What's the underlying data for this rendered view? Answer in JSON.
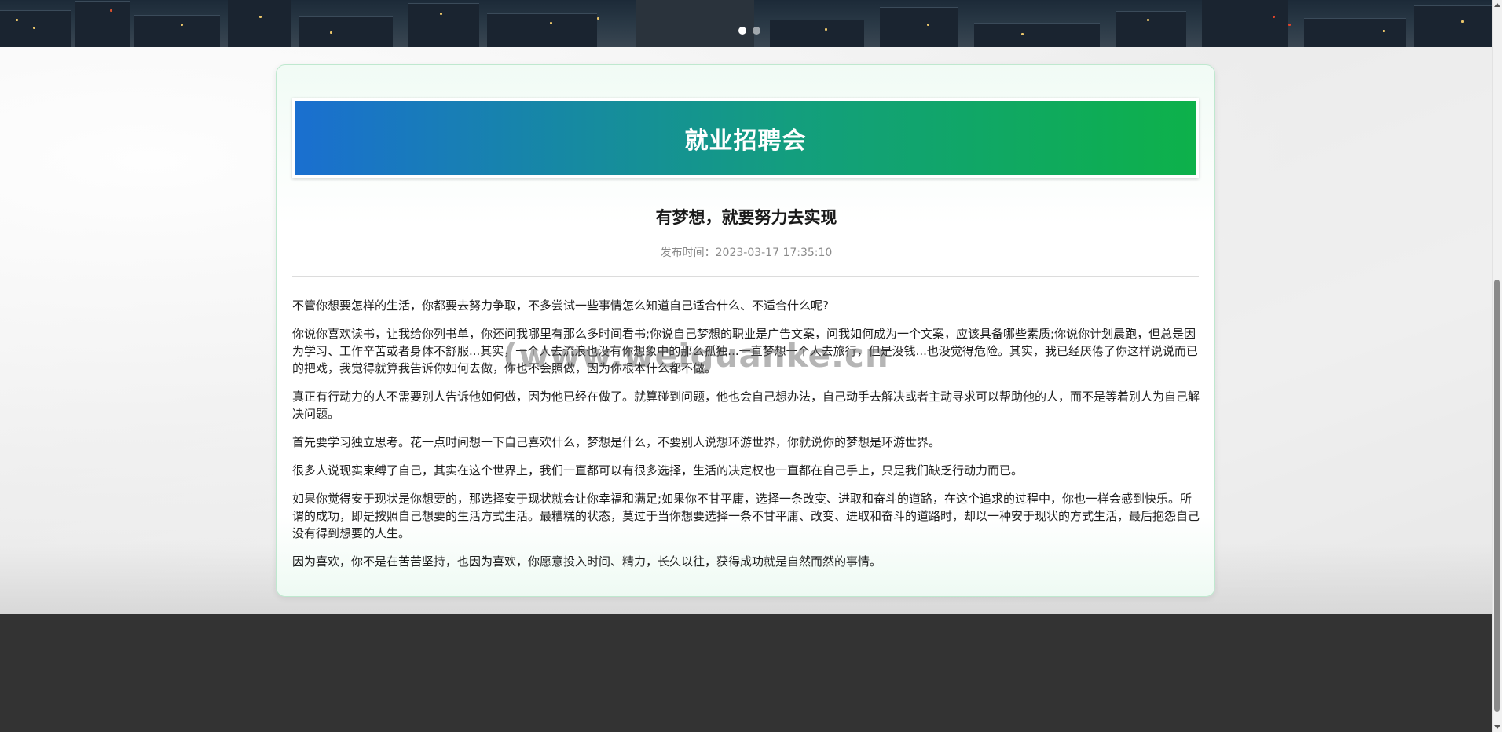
{
  "hero": {
    "slides": [
      {
        "active": true
      },
      {
        "active": false
      }
    ]
  },
  "card": {
    "banner_title": "就业招聘会",
    "article_title": "有梦想，就要努力去实现",
    "meta": "发布时间：2023-03-17 17:35:10",
    "paragraphs": [
      "不管你想要怎样的生活，你都要去努力争取，不多尝试一些事情怎么知道自己适合什么、不适合什么呢?",
      "你说你喜欢读书，让我给你列书单，你还问我哪里有那么多时间看书;你说自己梦想的职业是广告文案，问我如何成为一个文案，应该具备哪些素质;你说你计划晨跑，但总是因为学习、工作辛苦或者身体不舒服...其实，一个人去流浪也没有你想象中的那么孤独...一直梦想一个人去旅行，但是没钱...也没觉得危险。其实，我已经厌倦了你这样说说而已的把戏，我觉得就算我告诉你如何去做，你也不会照做，因为你根本什么都不做。",
      "真正有行动力的人不需要别人告诉他如何做，因为他已经在做了。就算碰到问题，他也会自己想办法，自己动手去解决或者主动寻求可以帮助他的人，而不是等着别人为自己解决问题。",
      "首先要学习独立思考。花一点时间想一下自己喜欢什么，梦想是什么，不要别人说想环游世界，你就说你的梦想是环游世界。",
      "很多人说现实束缚了自己，其实在这个世界上，我们一直都可以有很多选择，生活的决定权也一直都在自己手上，只是我们缺乏行动力而已。",
      "如果你觉得安于现状是你想要的，那选择安于现状就会让你幸福和满足;如果你不甘平庸，选择一条改变、进取和奋斗的道路，在这个追求的过程中，你也一样会感到快乐。所谓的成功，即是按照自己想要的生活方式生活。最糟糕的状态，莫过于当你想要选择一条不甘平庸、改变、进取和奋斗的道路时，却以一种安于现状的方式生活，最后抱怨自己没有得到想要的人生。",
      "因为喜欢，你不是在苦苦坚持，也因为喜欢，你愿意投入时间、精力，长久以往，获得成功就是自然而然的事情。"
    ]
  },
  "watermark": "(www.weiguanke.cn",
  "colors": {
    "banner_start": "#1a6fd0",
    "banner_end": "#0db14a",
    "footer": "#333333",
    "card_border": "#bfe8cf"
  }
}
